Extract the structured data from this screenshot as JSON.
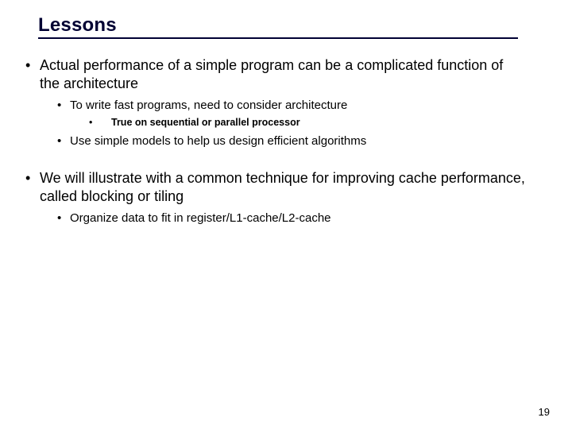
{
  "title": "Lessons",
  "bullets": {
    "b1": "Actual performance of a simple program can be a complicated function of the architecture",
    "b1_1": "To write fast programs, need to consider architecture",
    "b1_1_1": "True on sequential or parallel processor",
    "b1_2": "Use simple models to help us design efficient algorithms",
    "b2": "We will illustrate with a common technique for improving cache performance, called blocking or tiling",
    "b2_1": "Organize data to fit in register/L1-cache/L2-cache"
  },
  "page_number": "19"
}
